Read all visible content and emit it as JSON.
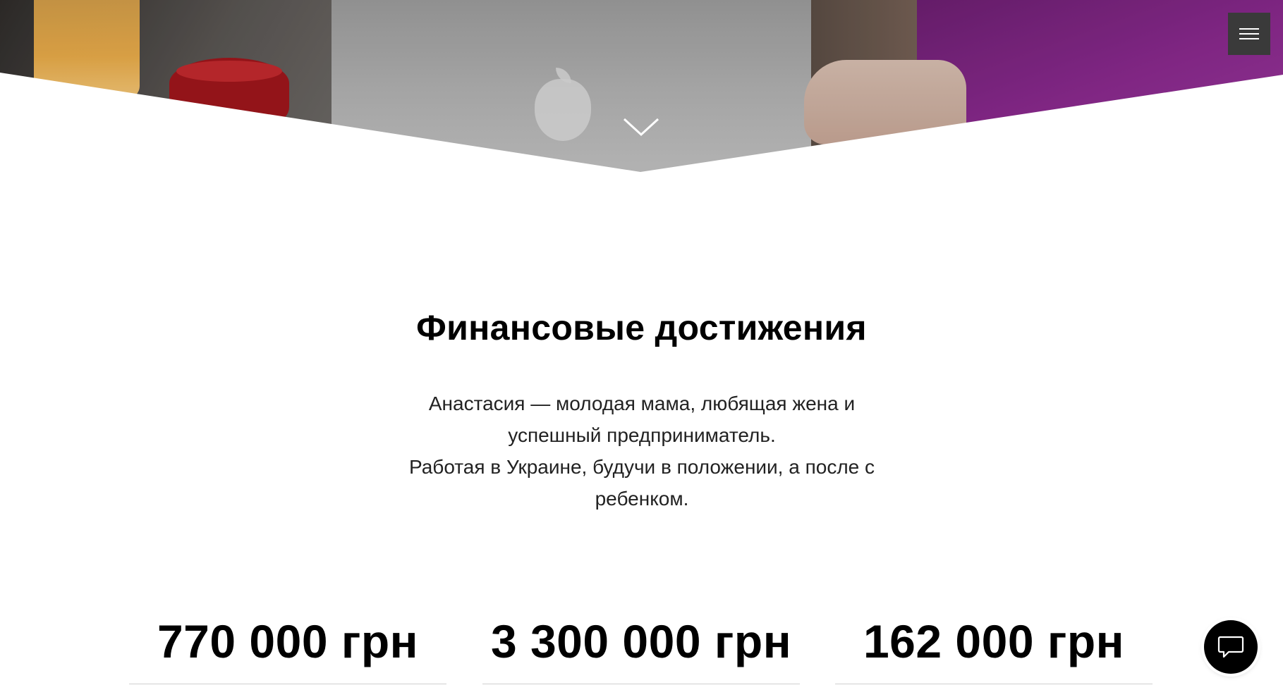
{
  "hero": {
    "scroll_icon": "chevron-down-icon",
    "menu_icon": "hamburger-menu-icon"
  },
  "section": {
    "title": "Финансовые достижения",
    "lead_lines": [
      "Анастасия — молодая мама, любящая жена и успешный предприниматель.",
      "Работая в Украине, будучи в положении, а после с ребенком."
    ]
  },
  "stats": [
    {
      "value": "770 000 грн"
    },
    {
      "value": "3 300 000 грн"
    },
    {
      "value": "162 000 грн"
    }
  ],
  "chat": {
    "icon": "chat-bubble-icon"
  },
  "colors": {
    "menu_bg": "#3a3a3a",
    "chat_bg": "#000000",
    "divider": "#cfcfcf"
  }
}
